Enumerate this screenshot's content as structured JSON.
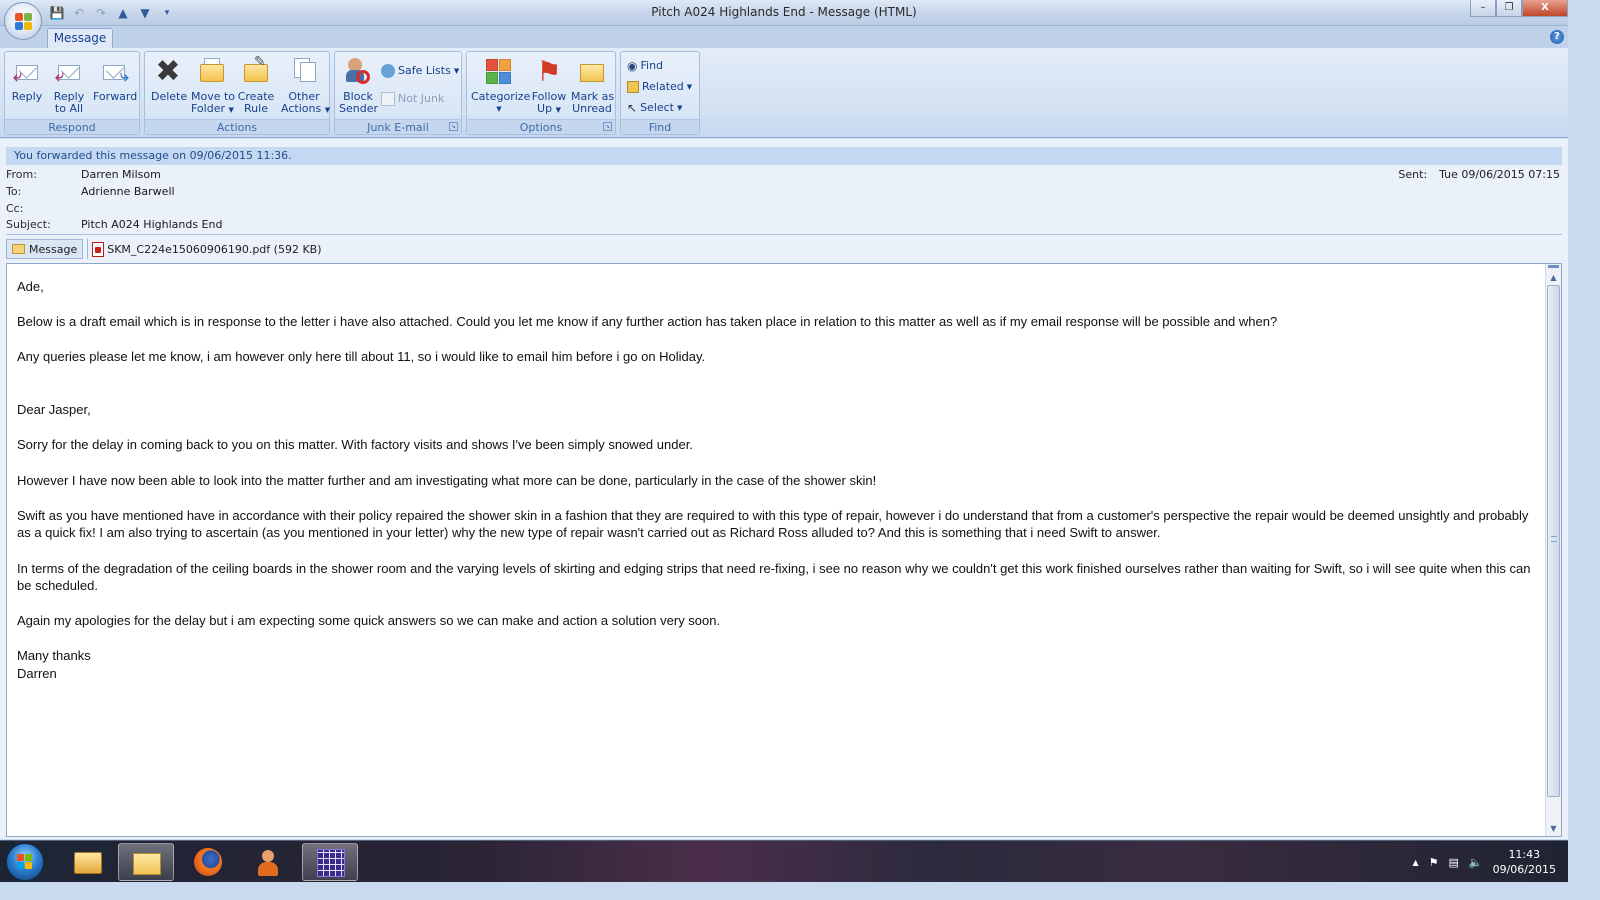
{
  "window": {
    "title": "Pitch A024 Highlands End - Message (HTML)",
    "controls": {
      "minimize": "–",
      "restore": "❐",
      "close": "X"
    }
  },
  "ribbon": {
    "tab": "Message",
    "help": "?",
    "groups": {
      "respond": {
        "label": "Respond",
        "reply": "Reply",
        "reply_all_1": "Reply",
        "reply_all_2": "to All",
        "forward": "Forward"
      },
      "actions": {
        "label": "Actions",
        "delete": "Delete",
        "move_1": "Move to",
        "move_2": "Folder",
        "rule_1": "Create",
        "rule_2": "Rule",
        "other_1": "Other",
        "other_2": "Actions"
      },
      "junk": {
        "label": "Junk E-mail",
        "block_1": "Block",
        "block_2": "Sender",
        "safe_lists": "Safe Lists",
        "not_junk": "Not Junk"
      },
      "options": {
        "label": "Options",
        "categorize": "Categorize",
        "follow_1": "Follow",
        "follow_2": "Up",
        "mark_1": "Mark as",
        "mark_2": "Unread"
      },
      "find": {
        "label": "Find",
        "find": "Find",
        "related": "Related",
        "select": "Select"
      }
    }
  },
  "message": {
    "info_bar": "You forwarded this message on 09/06/2015 11:36.",
    "from_label": "From:",
    "from": "Darren Milsom",
    "to_label": "To:",
    "to": "Adrienne Barwell",
    "cc_label": "Cc:",
    "cc": "",
    "subject_label": "Subject:",
    "subject": "Pitch A024 Highlands End",
    "sent_label": "Sent:",
    "sent": "Tue 09/06/2015 07:15",
    "attachments": {
      "message_tab": "Message",
      "file": "SKM_C224e15060906190.pdf (592 KB)"
    },
    "body": {
      "greeting": "Ade,",
      "p1": "Below is a draft email which is in response to the letter i have also attached. Could you let me know if any further action has taken place in relation to this matter as well as if my email response will be possible and when?",
      "p2": "Any queries please let me know, i am however only here till about 11, so i would like to email him before i go on Holiday.",
      "salutation": "Dear Jasper,",
      "p3": "Sorry for the delay in coming back to you on this matter. With factory visits and shows I've been simply snowed under.",
      "p4": "However I have now been able to look into the matter further and am investigating what more can be done, particularly in the case of the shower skin!",
      "p5": "Swift as you have mentioned have in accordance with their policy repaired the shower skin in a fashion that they are required to with this type of repair, however i do understand that from a customer's perspective the repair would be deemed unsightly and probably as a quick fix! I am also trying to ascertain (as you mentioned in your letter) why the new type of repair wasn't carried out as Richard Ross alluded to? And this is something that i need Swift to answer.",
      "p6": "In terms of the degradation of the ceiling boards in the shower room and the varying levels of skirting and edging strips that need re-fixing, i see no reason why we couldn't get this work finished ourselves rather than waiting for Swift, so i will see quite when this can be scheduled.",
      "p7": "Again my apologies for the delay but i am expecting some quick answers so we can make and action a solution very soon.",
      "signoff": "Many thanks",
      "signature": "Darren"
    }
  },
  "taskbar": {
    "time": "11:43",
    "date": "09/06/2015",
    "apps": [
      "windows-explorer-icon",
      "outlook-icon",
      "firefox-icon",
      "contacts-icon",
      "calendar-app-icon"
    ]
  },
  "colors": {
    "ribbon_text": "#15428b",
    "info_bar_bg": "#c5d8f1",
    "close_button": "#c0452a"
  }
}
